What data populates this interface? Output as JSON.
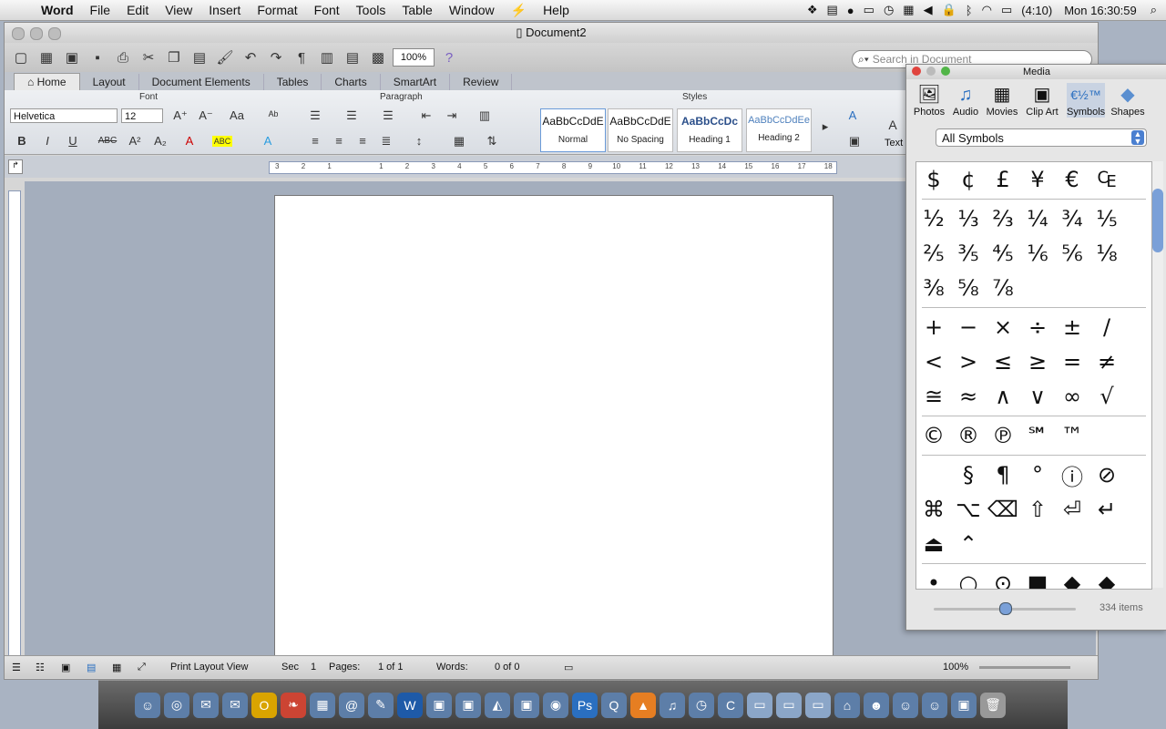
{
  "menubar": {
    "app_name": "Word",
    "menus": [
      "File",
      "Edit",
      "View",
      "Insert",
      "Format",
      "Font",
      "Tools",
      "Table",
      "Window",
      "Help"
    ],
    "battery": "(4:10)",
    "clock": "Mon 16:30:59"
  },
  "window": {
    "title": "Document2",
    "zoom": "100%",
    "search_placeholder": "Search in Document",
    "tabs": [
      "Home",
      "Layout",
      "Document Elements",
      "Tables",
      "Charts",
      "SmartArt",
      "Review"
    ]
  },
  "ribbon": {
    "font_group": "Font",
    "paragraph_group": "Paragraph",
    "styles_group": "Styles",
    "font_name": "Helvetica",
    "font_size": "12",
    "text_box_label": "Text",
    "styles": [
      {
        "preview": "AaBbCcDdE",
        "label": "Normal"
      },
      {
        "preview": "AaBbCcDdE",
        "label": "No Spacing"
      },
      {
        "preview": "AaBbCcDc",
        "label": "Heading 1"
      },
      {
        "preview": "AaBbCcDdEe",
        "label": "Heading 2"
      }
    ]
  },
  "ruler": {
    "labels": [
      "3",
      "2",
      "1",
      "1",
      "2",
      "3",
      "4",
      "5",
      "6",
      "7",
      "8",
      "9",
      "10",
      "11",
      "12",
      "13",
      "14",
      "15",
      "16",
      "17",
      "18"
    ]
  },
  "statusbar": {
    "view": "Print Layout View",
    "sec_label": "Sec",
    "sec_value": "1",
    "pages_label": "Pages:",
    "pages_value": "1 of 1",
    "words_label": "Words:",
    "words_value": "0 of 0",
    "zoom": "100%"
  },
  "toolbox": {
    "title": "Media",
    "buttons": [
      "Photos",
      "Audio",
      "Movies",
      "Clip Art",
      "Symbols",
      "Shapes"
    ],
    "dropdown": "All Symbols",
    "symbol_groups": [
      [
        [
          "$",
          "¢",
          "£",
          "¥",
          "€",
          "₠"
        ]
      ],
      [
        [
          "½",
          "⅓",
          "⅔",
          "¼",
          "¾",
          "⅕"
        ],
        [
          "⅖",
          "⅗",
          "⅘",
          "⅙",
          "⅚",
          "⅛"
        ],
        [
          "⅜",
          "⅝",
          "⅞"
        ]
      ],
      [
        [
          "+",
          "−",
          "×",
          "÷",
          "±",
          "/"
        ],
        [
          "<",
          ">",
          "≤",
          "≥",
          "=",
          "≠"
        ],
        [
          "≅",
          "≈",
          "∧",
          "∨",
          "∞",
          "√"
        ]
      ],
      [
        [
          "©",
          "®",
          "℗",
          "℠",
          "™"
        ]
      ],
      [
        [
          "",
          "§",
          "¶",
          "°",
          "ⓘ",
          "⊘"
        ],
        [
          "⌘",
          "⌥",
          "⌫",
          "⇧",
          "⏎",
          "↵"
        ],
        [
          "⏏",
          "⌃"
        ]
      ],
      [
        [
          "•",
          "○",
          "⊙",
          "■",
          "◆",
          "◆"
        ]
      ]
    ],
    "item_count": "334 items"
  }
}
